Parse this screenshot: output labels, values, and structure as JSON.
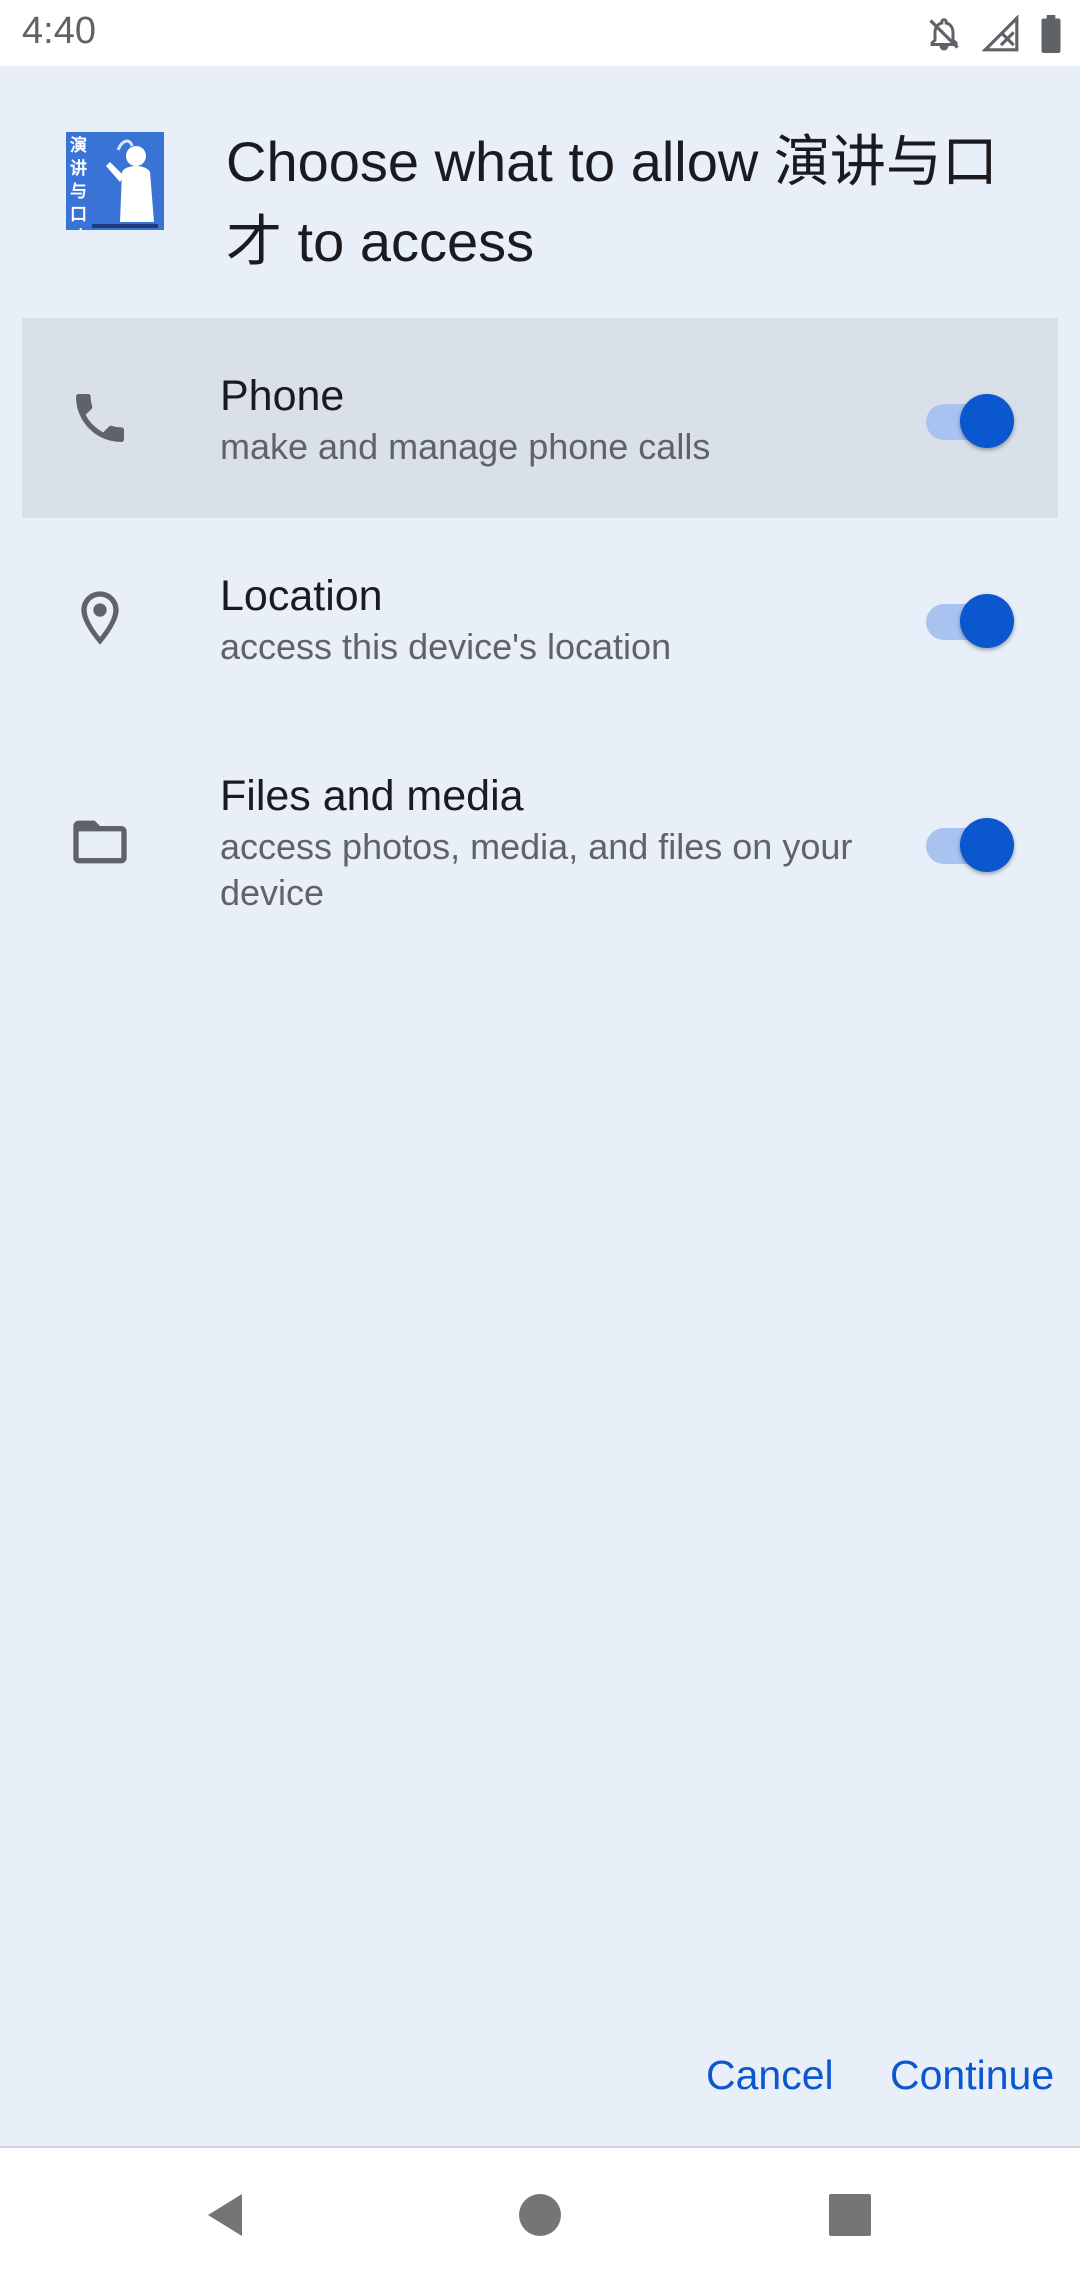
{
  "status_bar": {
    "time": "4:40",
    "icons": [
      "notifications-off-icon",
      "signal-off-icon",
      "battery-icon"
    ]
  },
  "dialog": {
    "app_icon": {
      "name": "app-icon",
      "chars": [
        "演",
        "讲",
        "与",
        "口",
        "才"
      ]
    },
    "title": "Choose what to allow 演讲与口才 to access",
    "permissions": [
      {
        "icon": "phone-icon",
        "title": "Phone",
        "description": "make and manage phone calls",
        "enabled": true,
        "selected": true
      },
      {
        "icon": "location-pin-icon",
        "title": "Location",
        "description": "access this device's location",
        "enabled": true,
        "selected": false
      },
      {
        "icon": "folder-icon",
        "title": "Files and media",
        "description": "access photos, media, and files on your device",
        "enabled": true,
        "selected": false
      }
    ],
    "buttons": {
      "cancel": "Cancel",
      "continue": "Continue"
    }
  },
  "navigation": {
    "icons": [
      "back-icon",
      "home-icon",
      "recents-icon"
    ]
  },
  "colors": {
    "background": "#e8eff9",
    "accent": "#0b57d0",
    "toggle_track": "#a8c3ef",
    "selected_row": "#d9e0ea"
  }
}
